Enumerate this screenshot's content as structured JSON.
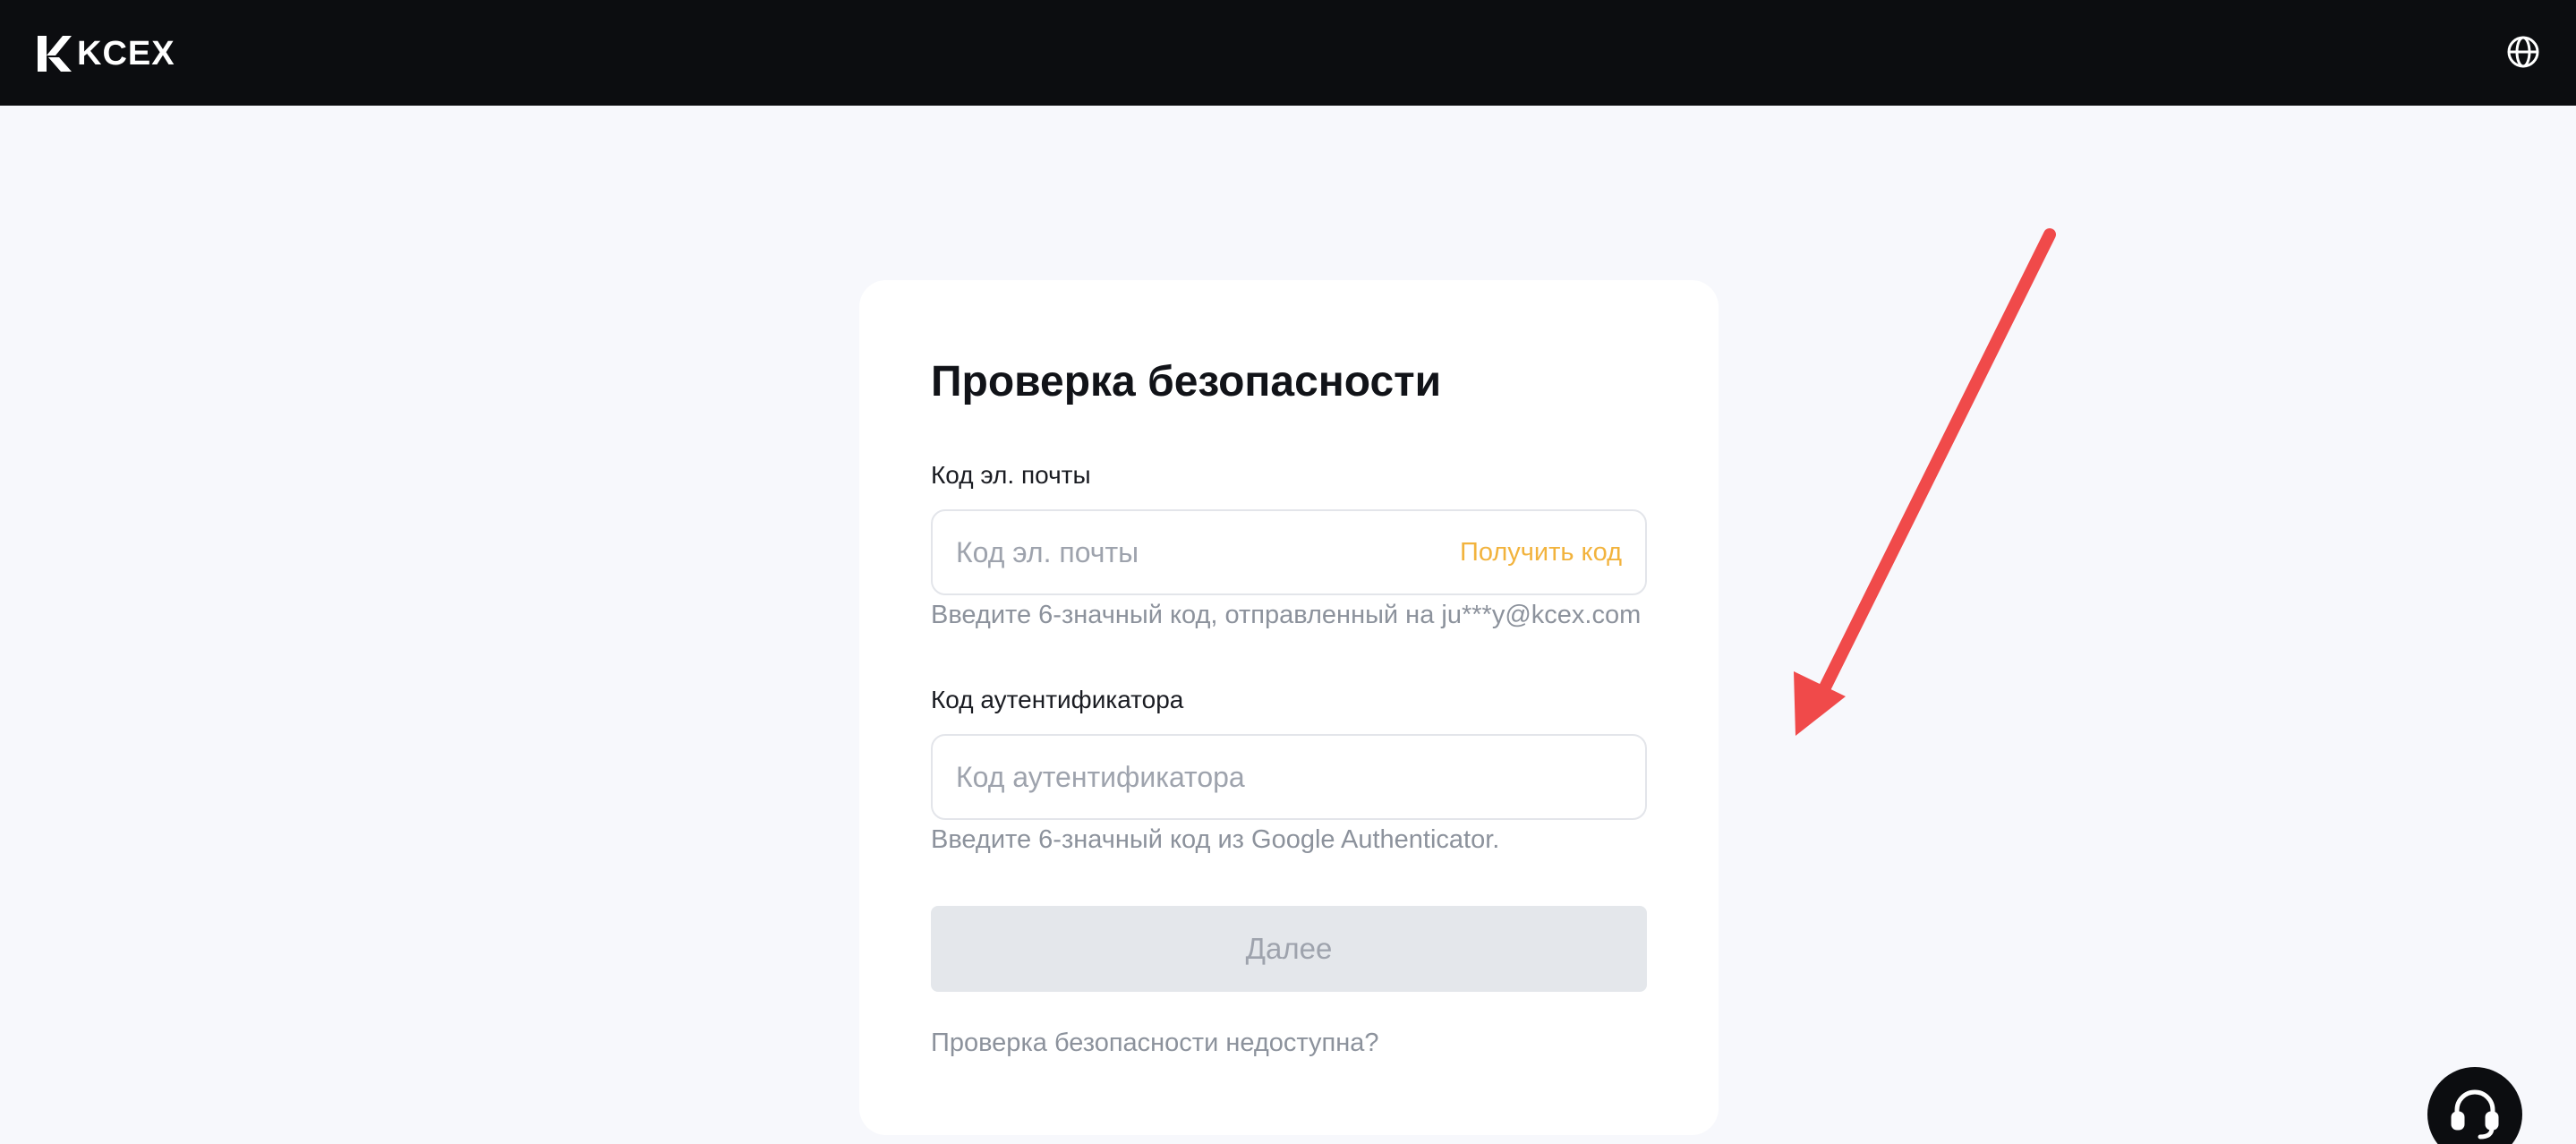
{
  "header": {
    "brand": "KCEX",
    "icons": {
      "logo": "kcex-logo-icon",
      "language": "globe-icon"
    }
  },
  "card": {
    "title": "Проверка безопасности",
    "email": {
      "label": "Код эл. почты",
      "placeholder": "Код эл. почты",
      "value": "",
      "get_code": "Получить код",
      "hint": "Введите 6-значный код, отправленный на ju***y@kcex.com"
    },
    "authenticator": {
      "label": "Код аутентификатора",
      "placeholder": "Код аутентификатора",
      "value": "",
      "hint": "Введите 6-значный код из Google Authenticator."
    },
    "next_button": "Далее",
    "unavailable_link": "Проверка безопасности недоступна?"
  },
  "support": {
    "icon": "headset-icon"
  },
  "annotation": {
    "icon": "red-arrow-icon",
    "color": "#f04a4a"
  },
  "colors": {
    "accent": "#f2b33d",
    "header_bg": "#0c0d10",
    "page_bg": "#f7f8fc",
    "button_disabled": "#e4e7eb"
  }
}
